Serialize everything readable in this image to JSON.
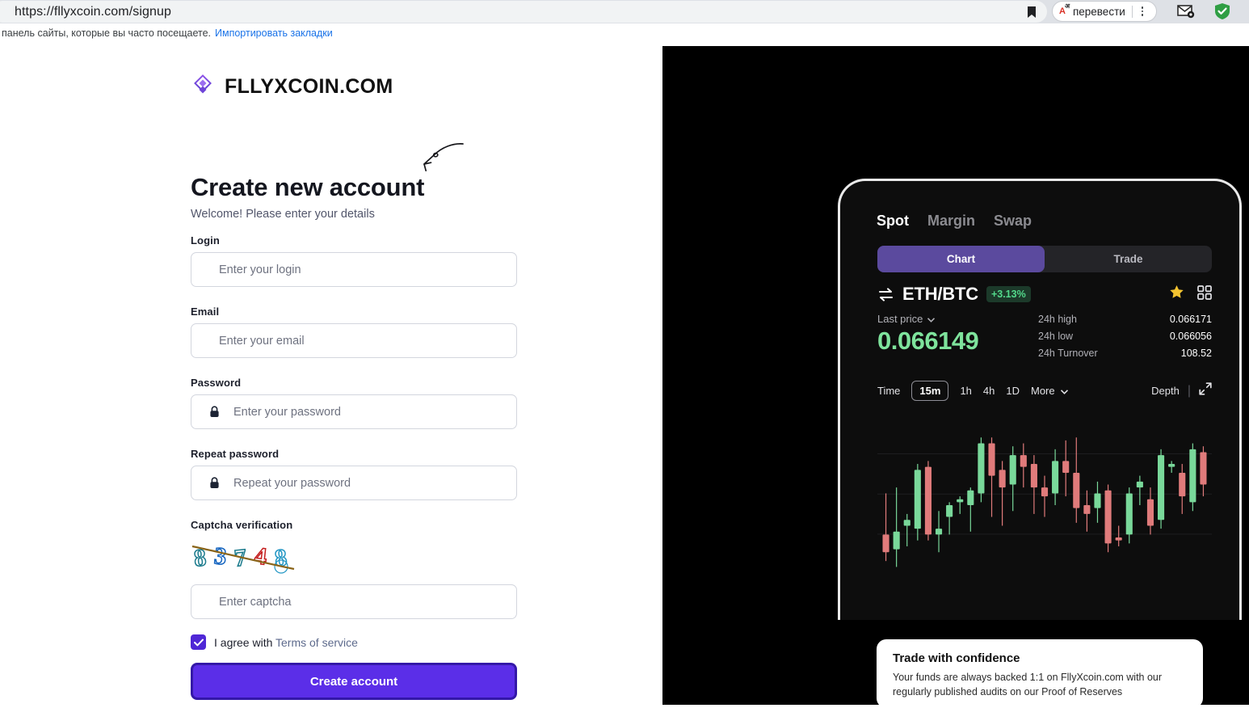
{
  "browser": {
    "url": "https://fllyxcoin.com/signup",
    "bookmark_bar_text": "панель сайты, которые вы часто посещаете.",
    "bookmark_bar_link": "Импортировать закладки",
    "translate_label": "перевести",
    "translate_glyph": "A",
    "translate_glyph_sup": "अ"
  },
  "brand": {
    "name": "FLLYXCOIN.COM",
    "logo_color": "#7b3fd4"
  },
  "signup": {
    "headline": "Create new account",
    "subhead": "Welcome! Please enter your details",
    "fields": [
      {
        "label": "Login",
        "placeholder": "Enter your login",
        "icon": ""
      },
      {
        "label": "Email",
        "placeholder": "Enter your email",
        "icon": ""
      },
      {
        "label": "Password",
        "placeholder": "Enter your password",
        "icon": "lock-icon"
      },
      {
        "label": "Repeat password",
        "placeholder": "Repeat your password",
        "icon": "lock-icon"
      },
      {
        "label": "Captcha verification",
        "placeholder": "Enter captcha",
        "icon": ""
      }
    ],
    "captcha_code": "83748",
    "captcha_digits": [
      {
        "d": "8",
        "color": "#1a7a8c"
      },
      {
        "d": "3",
        "color": "#1565c0"
      },
      {
        "d": "7",
        "color": "#1a7a8c"
      },
      {
        "d": "4",
        "color": "#c41e1e"
      },
      {
        "d": "8",
        "color": "#2196c4"
      }
    ],
    "terms_text": "I agree with ",
    "terms_link": "Terms of service",
    "terms_checked": true,
    "submit_label": "Create account",
    "accent_color": "#5b2ee8"
  },
  "app": {
    "segments": [
      {
        "label": "Spot",
        "active": true
      },
      {
        "label": "Margin",
        "active": false
      },
      {
        "label": "Swap",
        "active": false
      }
    ],
    "modes": [
      {
        "label": "Chart",
        "active": true
      },
      {
        "label": "Trade",
        "active": false
      }
    ],
    "pair": "ETH/BTC",
    "change": "+3.13%",
    "last_price_label": "Last price",
    "last_price": "0.066149",
    "stats": [
      {
        "key": "24h high",
        "value": "0.066171"
      },
      {
        "key": "24h low",
        "value": "0.066056"
      },
      {
        "key": "24h Turnover",
        "value": "108.52"
      }
    ],
    "timeframes": [
      {
        "label": "Time",
        "active": false,
        "boxed": false
      },
      {
        "label": "15m",
        "active": true,
        "boxed": true
      },
      {
        "label": "1h",
        "active": false,
        "boxed": false
      },
      {
        "label": "4h",
        "active": false,
        "boxed": false
      },
      {
        "label": "1D",
        "active": false,
        "boxed": false
      },
      {
        "label": "More",
        "active": false,
        "boxed": false
      }
    ],
    "depth_label": "Depth",
    "up_color": "#79d89a",
    "down_color": "#e07b7b"
  },
  "promo": {
    "title": "Trade with confidence",
    "body": "Your funds are always backed 1:1 on FllyXcoin.com with our regularly published audits on our Proof of Reserves"
  },
  "chart_data": {
    "type": "candlestick",
    "title": "ETH/BTC 15m candles",
    "xlabel": "",
    "ylabel": "",
    "candles": [
      {
        "o": 30,
        "h": 58,
        "l": 12,
        "c": 18,
        "dir": "down"
      },
      {
        "o": 32,
        "h": 62,
        "l": 8,
        "c": 20,
        "dir": "up"
      },
      {
        "o": 36,
        "h": 44,
        "l": 22,
        "c": 40,
        "dir": "up"
      },
      {
        "o": 34,
        "h": 78,
        "l": 26,
        "c": 74,
        "dir": "up"
      },
      {
        "o": 76,
        "h": 80,
        "l": 26,
        "c": 30,
        "dir": "down"
      },
      {
        "o": 34,
        "h": 46,
        "l": 18,
        "c": 30,
        "dir": "up"
      },
      {
        "o": 42,
        "h": 52,
        "l": 30,
        "c": 50,
        "dir": "up"
      },
      {
        "o": 52,
        "h": 56,
        "l": 44,
        "c": 54,
        "dir": "up"
      },
      {
        "o": 50,
        "h": 62,
        "l": 32,
        "c": 60,
        "dir": "up"
      },
      {
        "o": 58,
        "h": 96,
        "l": 52,
        "c": 92,
        "dir": "up"
      },
      {
        "o": 92,
        "h": 96,
        "l": 42,
        "c": 70,
        "dir": "down"
      },
      {
        "o": 74,
        "h": 80,
        "l": 36,
        "c": 62,
        "dir": "down"
      },
      {
        "o": 64,
        "h": 90,
        "l": 46,
        "c": 84,
        "dir": "up"
      },
      {
        "o": 84,
        "h": 92,
        "l": 62,
        "c": 76,
        "dir": "down"
      },
      {
        "o": 78,
        "h": 84,
        "l": 44,
        "c": 62,
        "dir": "down"
      },
      {
        "o": 62,
        "h": 70,
        "l": 42,
        "c": 56,
        "dir": "down"
      },
      {
        "o": 58,
        "h": 88,
        "l": 50,
        "c": 80,
        "dir": "up"
      },
      {
        "o": 80,
        "h": 94,
        "l": 56,
        "c": 72,
        "dir": "down"
      },
      {
        "o": 72,
        "h": 96,
        "l": 38,
        "c": 48,
        "dir": "down"
      },
      {
        "o": 50,
        "h": 60,
        "l": 32,
        "c": 44,
        "dir": "down"
      },
      {
        "o": 48,
        "h": 66,
        "l": 38,
        "c": 58,
        "dir": "up"
      },
      {
        "o": 60,
        "h": 64,
        "l": 18,
        "c": 24,
        "dir": "down"
      },
      {
        "o": 28,
        "h": 36,
        "l": 22,
        "c": 26,
        "dir": "down"
      },
      {
        "o": 30,
        "h": 62,
        "l": 24,
        "c": 58,
        "dir": "up"
      },
      {
        "o": 62,
        "h": 70,
        "l": 50,
        "c": 66,
        "dir": "up"
      },
      {
        "o": 54,
        "h": 62,
        "l": 30,
        "c": 36,
        "dir": "down"
      },
      {
        "o": 40,
        "h": 88,
        "l": 34,
        "c": 84,
        "dir": "up"
      },
      {
        "o": 76,
        "h": 80,
        "l": 72,
        "c": 78,
        "dir": "up"
      },
      {
        "o": 72,
        "h": 78,
        "l": 44,
        "c": 56,
        "dir": "down"
      },
      {
        "o": 52,
        "h": 92,
        "l": 46,
        "c": 88,
        "dir": "up"
      },
      {
        "o": 86,
        "h": 90,
        "l": 56,
        "c": 64,
        "dir": "down"
      }
    ]
  }
}
